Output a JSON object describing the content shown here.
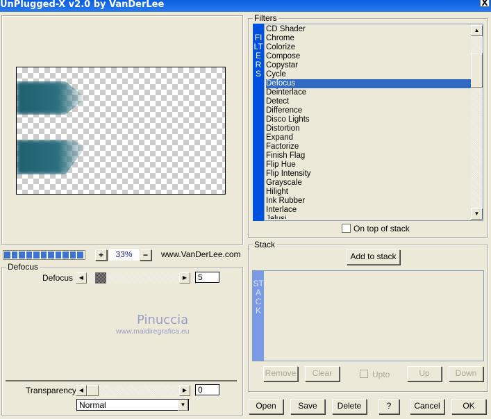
{
  "window": {
    "title": "UnPlugged-X v2.0 by VanDerLee",
    "close": "X"
  },
  "preview": {
    "zoom": "33%",
    "plus": "+",
    "minus": "−",
    "website": "www.VanDerLee.com",
    "progress_segments": 11
  },
  "params": {
    "group_label": "Defocus",
    "defocus_label": "Defocus",
    "defocus_value": "5",
    "transparency_label": "Transparency",
    "transparency_value": "0",
    "blend_mode": "Normal"
  },
  "watermark": {
    "name": "Pinuccia",
    "url": "www.maidiregrafica.eu"
  },
  "filters": {
    "group_label": "Filters",
    "side_label": "FILTERS",
    "selected": "Defocus",
    "items": [
      "CD Shader",
      "Chrome",
      "Colorize",
      "Compose",
      "Copystar",
      "Cycle",
      "Defocus",
      "Deinterlace",
      "Detect",
      "Difference",
      "Disco Lights",
      "Distortion",
      "Expand",
      "Factorize",
      "Finish Flag",
      "Flip Hue",
      "Flip Intensity",
      "Grayscale",
      "Hilight",
      "Ink Rubber",
      "Interlace",
      "Jalusi"
    ],
    "on_top_label": "On top of stack"
  },
  "stack": {
    "group_label": "Stack",
    "side_label": "STACK",
    "add": "Add to stack",
    "remove": "Remove",
    "clear": "Clear",
    "upto": "Upto",
    "up": "Up",
    "down": "Down"
  },
  "footer": {
    "open": "Open",
    "save": "Save",
    "delete": "Delete",
    "help": "?",
    "cancel": "Cancel",
    "ok": "OK"
  },
  "colors": {
    "title": "#0a5fe0",
    "selection": "#316ac5",
    "filters_strip": "#0050e0",
    "stack_strip": "#7b9ae6"
  }
}
